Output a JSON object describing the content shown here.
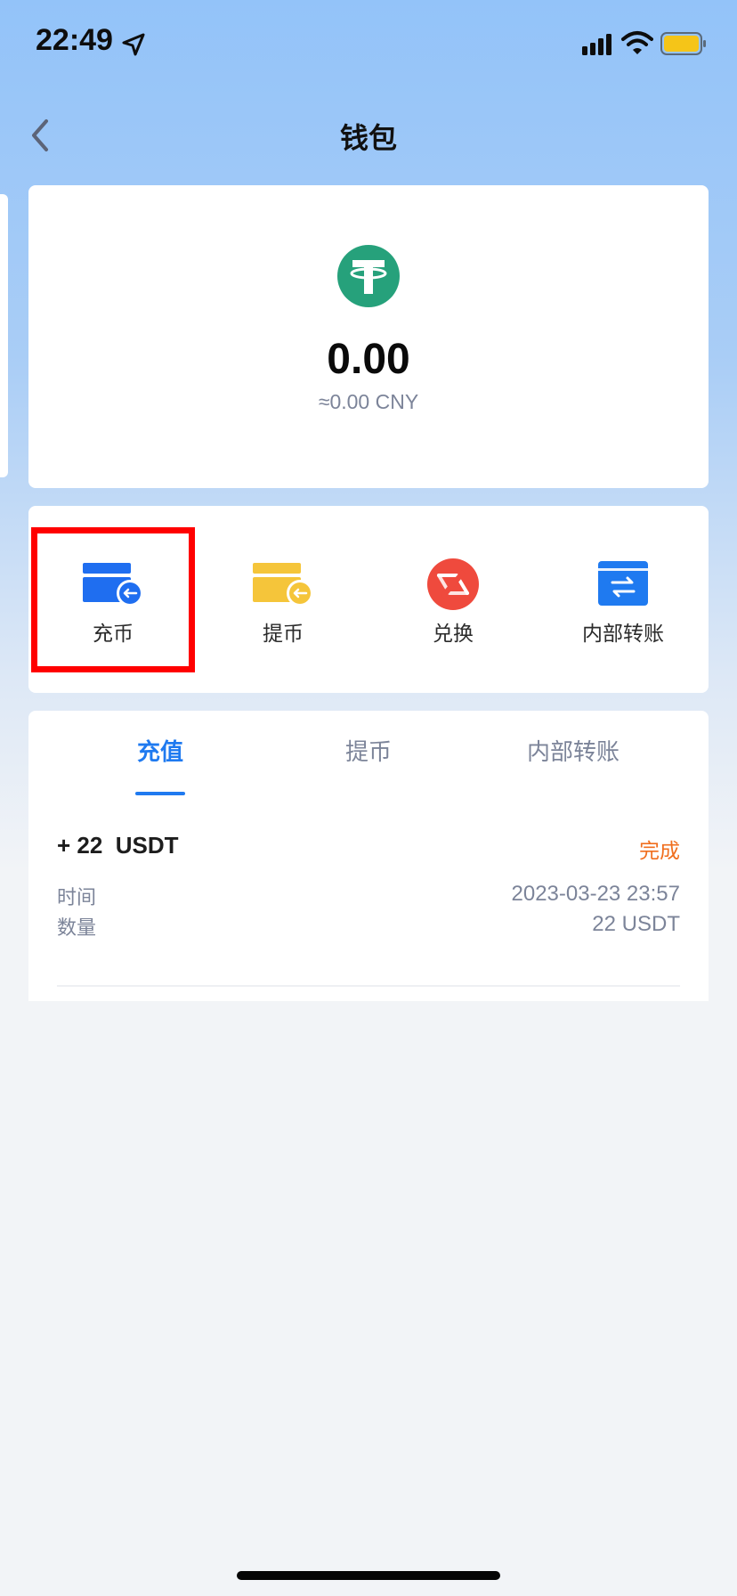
{
  "status_bar": {
    "time": "22:49",
    "icons": [
      "location-arrow-icon",
      "cellular-signal-icon",
      "wifi-icon",
      "battery-icon"
    ],
    "battery_color": "#f5c518"
  },
  "nav": {
    "title": "钱包",
    "back_icon": "chevron-left-icon"
  },
  "balance": {
    "coin_icon": "usdt-tether-icon",
    "coin_color": "#26a17b",
    "amount": "0.00",
    "cny": "≈0.00 CNY"
  },
  "actions": [
    {
      "label": "充币",
      "icon": "deposit-card-icon",
      "color": "#1f6ef0",
      "highlighted": true
    },
    {
      "label": "提币",
      "icon": "withdraw-card-icon",
      "color": "#f5c53a",
      "highlighted": false
    },
    {
      "label": "兑换",
      "icon": "exchange-icon",
      "color": "#ef4a3d",
      "highlighted": false
    },
    {
      "label": "内部转账",
      "icon": "transfer-icon",
      "color": "#1f7af0",
      "highlighted": false
    }
  ],
  "tabs": [
    {
      "label": "充值",
      "active": true
    },
    {
      "label": "提币",
      "active": false
    },
    {
      "label": "内部转账",
      "active": false
    }
  ],
  "records": [
    {
      "amount": "+ 22  USDT",
      "status": "完成",
      "time_label": "时间",
      "time_value": "2023-03-23 23:57",
      "qty_label": "数量",
      "qty_value": "22 USDT"
    }
  ],
  "colors": {
    "accent": "#1f7af0",
    "status_done": "#f06e1e",
    "highlight_border": "#ff0000"
  }
}
